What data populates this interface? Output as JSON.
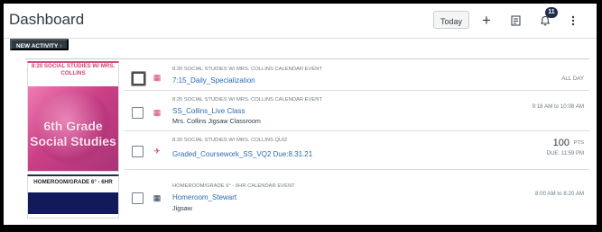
{
  "header": {
    "title": "Dashboard",
    "today_label": "Today",
    "add_label": "+",
    "notification_count": "11"
  },
  "new_activity": {
    "label": "NEW ACTIVITY ↑"
  },
  "courses": [
    {
      "title": "8:20 SOCIAL STUDIES W/ MRS. COLLINS",
      "image_text": "6th  Grade\nSocial Studies",
      "items": [
        {
          "context": "8:20 SOCIAL STUDIES W/ MRS. COLLINS CALENDAR EVENT",
          "title": "7:15_Daily_Specialization",
          "meta": "ALL DAY",
          "icon": "calendar-icon",
          "checked": false
        },
        {
          "context": "8:20 SOCIAL STUDIES W/ MRS. COLLINS CALENDAR EVENT",
          "title": "SS_Collins_Live Class",
          "subtitle": "Mrs. Collins Jigsaw Classroom",
          "meta": "9:18 AM to 10:08 AM",
          "icon": "calendar-icon",
          "checked": false
        },
        {
          "context": "8:20 SOCIAL STUDIES W/ MRS. COLLINS QUIZ",
          "title": "Graded_Coursework_SS_VQ2 Due:8.31.21",
          "points": "100",
          "points_label": "PTS",
          "due": "DUE: 11:59 PM",
          "icon": "quiz-icon",
          "checked": false
        }
      ]
    },
    {
      "title": "HOMEROOM/GRADE 6° - 6HR",
      "items": [
        {
          "context": "HOMEROOM/GRADE 6° - 6HR CALENDAR EVENT",
          "title": "Homeroom_Stewart",
          "subtitle": "Jigsaw",
          "meta": "8:00 AM to 8:20 AM",
          "icon": "calendar-icon",
          "checked": false
        }
      ]
    }
  ],
  "colors": {
    "accent_pink": "#d63c74",
    "accent_navy": "#131a5b",
    "link_blue": "#2b6cb0"
  }
}
